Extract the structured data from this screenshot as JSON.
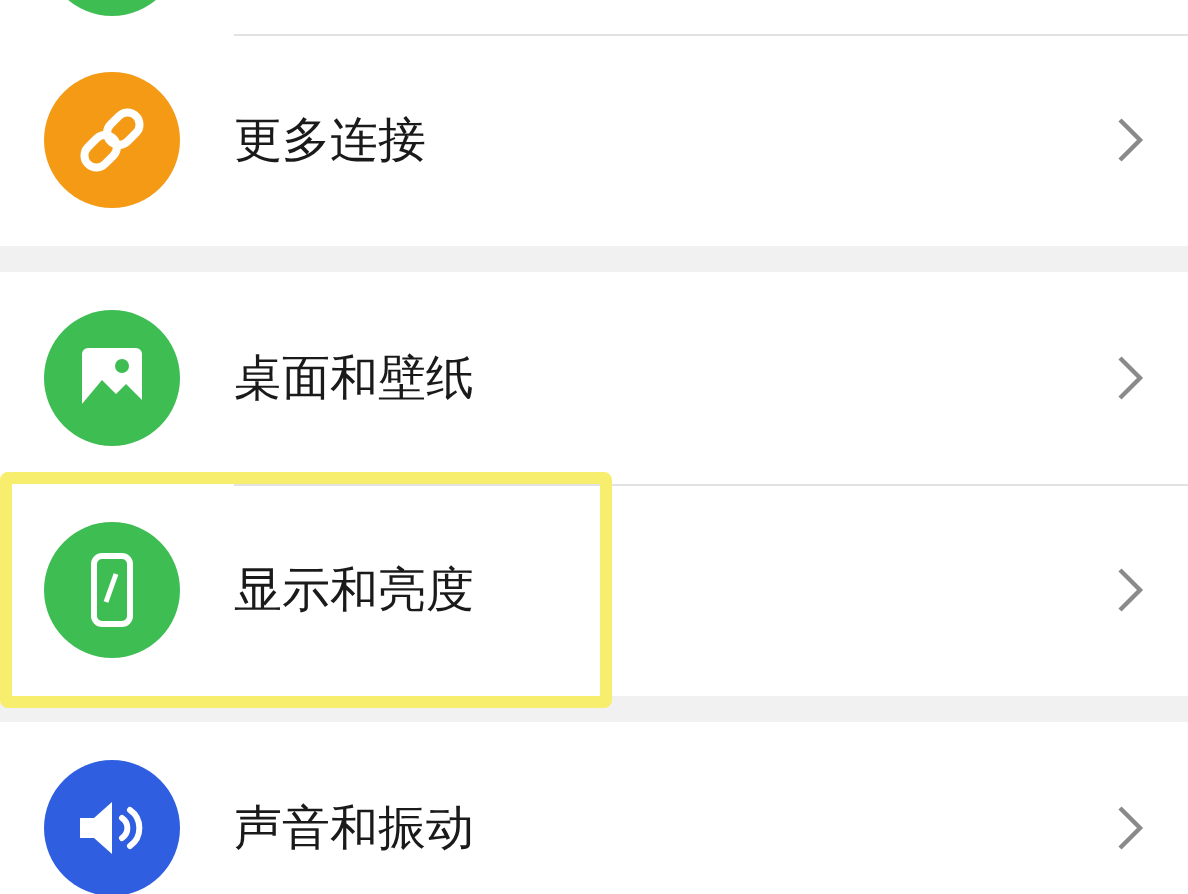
{
  "sections": [
    {
      "items": [
        {
          "kind": "partial",
          "color": "#3dbd52"
        },
        {
          "kind": "link",
          "label": "更多连接",
          "color": "#f59a14",
          "highlighted": false
        }
      ]
    },
    {
      "items": [
        {
          "kind": "image",
          "label": "桌面和壁纸",
          "color": "#3dbd52",
          "highlighted": false
        },
        {
          "kind": "phone",
          "label": "显示和亮度",
          "color": "#3dbd52",
          "highlighted": true
        }
      ]
    },
    {
      "items": [
        {
          "kind": "speaker",
          "label": "声音和振动",
          "color": "#2f5fe0",
          "highlighted": false
        }
      ]
    }
  ]
}
